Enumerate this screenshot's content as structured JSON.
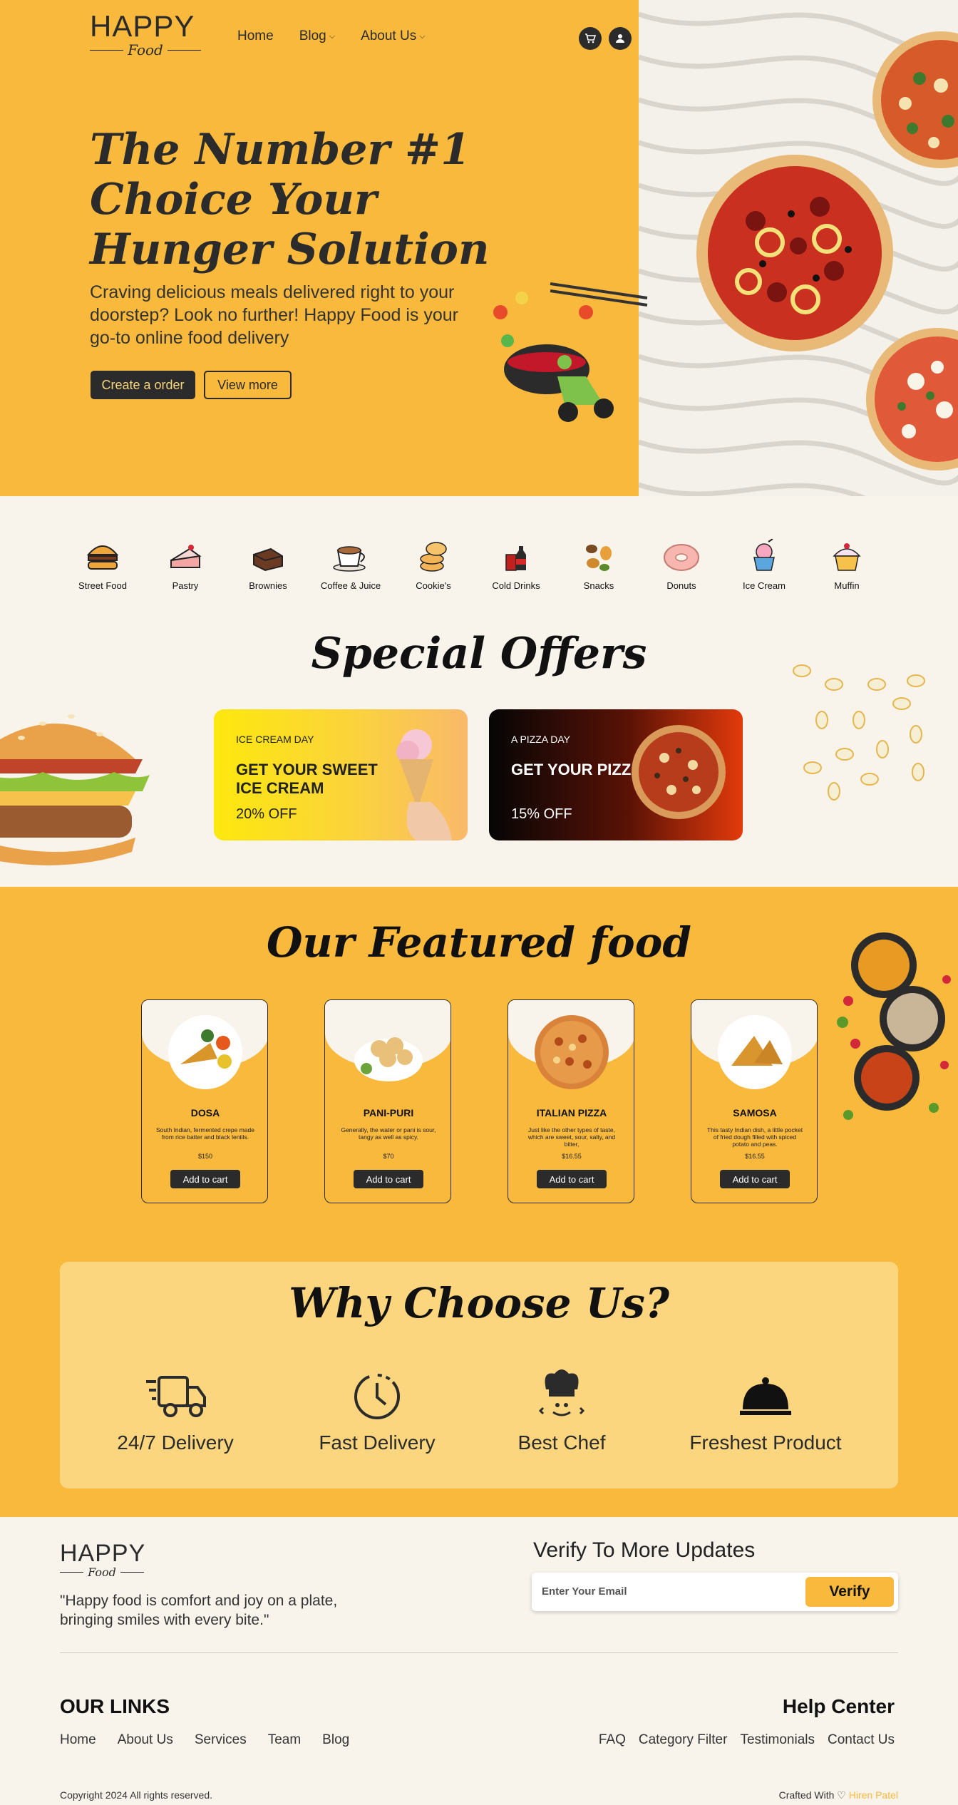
{
  "brand": {
    "name": "HAPPY",
    "sub": "Food"
  },
  "nav": {
    "home": "Home",
    "blog": "Blog",
    "about": "About Us"
  },
  "header_icons": [
    "cart-icon",
    "user-icon"
  ],
  "hero": {
    "title": "The Number #1 Choice Your Hunger Solution",
    "description": "Craving delicious meals delivered right to your doorstep? Look no further! Happy Food is your go-to online food delivery",
    "cta_primary": "Create a order",
    "cta_secondary": "View more"
  },
  "categories": [
    "Street Food",
    "Pastry",
    "Brownies",
    "Coffee & Juice",
    "Cookie's",
    "Cold Drinks",
    "Snacks",
    "Donuts",
    "Ice Cream",
    "Muffin"
  ],
  "special": {
    "title": "Special Offers",
    "offers": [
      {
        "kicker": "ICE CREAM DAY",
        "headline": "GET YOUR SWEET ICE CREAM",
        "discount": "20% OFF"
      },
      {
        "kicker": "A PIZZA DAY",
        "headline": "GET YOUR PIZZA",
        "discount": "15% OFF"
      }
    ]
  },
  "featured": {
    "title": "Our Featured food",
    "items": [
      {
        "name": "DOSA",
        "desc": "South Indian, fermented crepe made from rice batter and black lentils.",
        "price": "$150",
        "button": "Add to cart"
      },
      {
        "name": "PANI-PURI",
        "desc": "Generally, the water or pani is sour, tangy as well as spicy.",
        "price": "$70",
        "button": "Add to cart"
      },
      {
        "name": "ITALIAN PIZZA",
        "desc": "Just like the other types of taste, which are sweet, sour, salty, and bitter,",
        "price": "$16.55",
        "button": "Add to cart"
      },
      {
        "name": "SAMOSA",
        "desc": "This tasty Indian dish, a little pocket of fried dough filled with spiced potato and peas.",
        "price": "$16.55",
        "button": "Add to cart"
      }
    ]
  },
  "why": {
    "title": "Why Choose Us?",
    "items": [
      "24/7 Delivery",
      "Fast Delivery",
      "Best Chef",
      "Freshest Product"
    ]
  },
  "footer": {
    "quote": "\"Happy food is comfort and joy on a plate, bringing smiles with every bite.\"",
    "verify_title": "Verify To More Updates",
    "email_placeholder": "Enter Your Email",
    "verify_button": "Verify",
    "links_title": "OUR LINKS",
    "links": [
      "Home",
      "About Us",
      "Services",
      "Team",
      "Blog"
    ],
    "help_title": "Help Center",
    "help_links": [
      "FAQ",
      "Category Filter",
      "Testimonials",
      "Contact Us"
    ],
    "copyright": "Copyright 2024 All rights reserved.",
    "crafted": "Crafted With",
    "author": "Hiren Patel"
  },
  "colors": {
    "accent": "#f9b93d",
    "dark": "#2b2b2b",
    "cream": "#f8f4ec"
  }
}
